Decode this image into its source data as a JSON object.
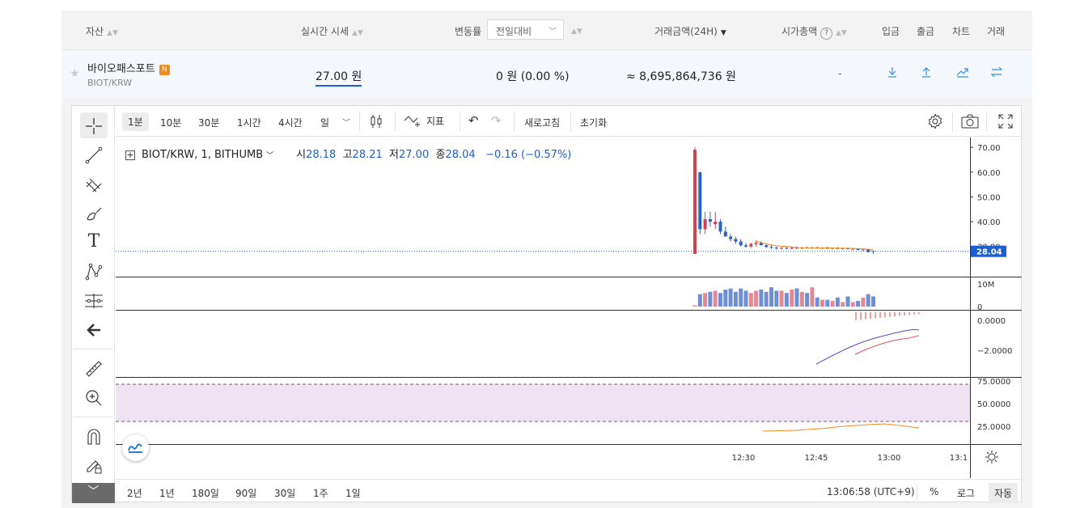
{
  "header": {
    "asset": "자산",
    "price": "실시간 시세",
    "change": "변동률",
    "change_select": "전일대비",
    "volume": "거래금액(24H)",
    "mcap": "시가총액",
    "help": "?",
    "deposit": "입금",
    "withdraw": "출금",
    "chart": "차트",
    "trade": "거래"
  },
  "coin": {
    "name": "바이오패스포트",
    "badge": "N",
    "symbol": "BIOT/KRW",
    "price": "27.00 원",
    "change": "0 원 (0.00 %)",
    "amount": "≈ 8,695,864,736 원",
    "mcap": "-"
  },
  "toolbar": {
    "intervals": [
      "1분",
      "10분",
      "30분",
      "1시간",
      "4시간",
      "일"
    ],
    "indicators": "지표",
    "refresh": "새로고침",
    "reset": "초기화"
  },
  "legend": {
    "title": "BIOT/KRW, 1, BITHUMB",
    "o_label": "시",
    "o": "28.18",
    "h_label": "고",
    "h": "28.21",
    "l_label": "저",
    "l": "27.00",
    "c_label": "종",
    "c": "28.04",
    "delta": "−0.16 (−0.57%)"
  },
  "axes": {
    "price_ticks": [
      "70.00",
      "60.00",
      "50.00",
      "40.00",
      "30.00"
    ],
    "last_price": "28.04",
    "volume_ticks": [
      "10M",
      "0"
    ],
    "macd_ticks": [
      "0.0000",
      "−2.0000"
    ],
    "rsi_ticks": [
      "75.0000",
      "50.0000",
      "25.0000"
    ],
    "time_ticks": [
      "12:30",
      "12:45",
      "13:00",
      "13:1"
    ]
  },
  "ranges": [
    "2년",
    "1년",
    "180일",
    "90일",
    "30일",
    "1주",
    "1일"
  ],
  "clock": "13:06:58 (UTC+9)",
  "scale_opts": [
    "%",
    "로그",
    "자동"
  ],
  "colors": {
    "up": "#d0424f",
    "down": "#2a63c5",
    "accent": "#1c5fd1",
    "rsi_band": "#efe3f3"
  },
  "chart_data": {
    "type": "candlestick",
    "ylim": [
      25,
      72
    ],
    "candles": [
      {
        "o": 27.0,
        "h": 70.0,
        "l": 27.0,
        "c": 69.0
      },
      {
        "o": 60.0,
        "h": 60.0,
        "l": 35.0,
        "c": 37.0
      },
      {
        "o": 37.0,
        "h": 44.0,
        "l": 35.0,
        "c": 41.0
      },
      {
        "o": 41.0,
        "h": 44.0,
        "l": 38.0,
        "c": 40.0
      },
      {
        "o": 39.0,
        "h": 44.0,
        "l": 37.0,
        "c": 40.0
      },
      {
        "o": 40.0,
        "h": 41.0,
        "l": 35.0,
        "c": 36.0
      },
      {
        "o": 36.0,
        "h": 38.0,
        "l": 34.0,
        "c": 34.0
      },
      {
        "o": 34.0,
        "h": 35.0,
        "l": 32.0,
        "c": 33.0
      },
      {
        "o": 33.0,
        "h": 34.0,
        "l": 31.0,
        "c": 32.0
      },
      {
        "o": 32.0,
        "h": 33.0,
        "l": 30.0,
        "c": 30.5
      },
      {
        "o": 30.5,
        "h": 31.5,
        "l": 29.5,
        "c": 30.0
      },
      {
        "o": 30.0,
        "h": 31.5,
        "l": 29.5,
        "c": 31.0
      },
      {
        "o": 31.0,
        "h": 32.5,
        "l": 30.0,
        "c": 31.5
      },
      {
        "o": 31.5,
        "h": 32.0,
        "l": 30.5,
        "c": 30.5
      },
      {
        "o": 30.5,
        "h": 31.0,
        "l": 29.5,
        "c": 29.8
      },
      {
        "o": 29.8,
        "h": 30.5,
        "l": 29.0,
        "c": 29.5
      },
      {
        "o": 29.5,
        "h": 30.0,
        "l": 28.8,
        "c": 29.2
      },
      {
        "o": 29.2,
        "h": 29.8,
        "l": 28.8,
        "c": 29.4
      },
      {
        "o": 29.4,
        "h": 29.9,
        "l": 28.9,
        "c": 29.1
      },
      {
        "o": 29.1,
        "h": 29.7,
        "l": 28.8,
        "c": 29.5
      },
      {
        "o": 29.5,
        "h": 30.0,
        "l": 29.0,
        "c": 29.2
      },
      {
        "o": 29.2,
        "h": 29.8,
        "l": 28.9,
        "c": 29.6
      },
      {
        "o": 29.6,
        "h": 30.0,
        "l": 29.2,
        "c": 29.3
      },
      {
        "o": 29.3,
        "h": 29.8,
        "l": 29.0,
        "c": 29.6
      },
      {
        "o": 29.6,
        "h": 29.9,
        "l": 29.1,
        "c": 29.2
      },
      {
        "o": 29.2,
        "h": 29.7,
        "l": 28.9,
        "c": 29.5
      },
      {
        "o": 29.5,
        "h": 29.9,
        "l": 29.0,
        "c": 29.1
      },
      {
        "o": 29.1,
        "h": 29.6,
        "l": 28.8,
        "c": 29.4
      },
      {
        "o": 29.4,
        "h": 29.8,
        "l": 29.0,
        "c": 29.0
      },
      {
        "o": 29.0,
        "h": 29.5,
        "l": 28.7,
        "c": 29.3
      },
      {
        "o": 29.3,
        "h": 29.6,
        "l": 28.8,
        "c": 28.9
      },
      {
        "o": 28.9,
        "h": 29.4,
        "l": 28.6,
        "c": 29.1
      },
      {
        "o": 29.1,
        "h": 29.3,
        "l": 28.5,
        "c": 28.6
      },
      {
        "o": 28.6,
        "h": 29.0,
        "l": 28.2,
        "c": 28.8
      },
      {
        "o": 28.8,
        "h": 29.0,
        "l": 27.5,
        "c": 27.8
      },
      {
        "o": 28.18,
        "h": 28.21,
        "l": 27.0,
        "c": 28.04
      }
    ],
    "volume": [
      0.5,
      5.5,
      6.0,
      6.5,
      7.0,
      6.0,
      7.5,
      8.0,
      6.5,
      8.0,
      7.0,
      6.0,
      7.0,
      7.5,
      6.5,
      8.5,
      7.0,
      7.0,
      6.0,
      7.5,
      8.0,
      6.5,
      6.0,
      8.5,
      4.0,
      3.0,
      3.0,
      2.5,
      4.0,
      2.0,
      4.5,
      2.0,
      2.5,
      4.0,
      5.5,
      4.5
    ]
  }
}
